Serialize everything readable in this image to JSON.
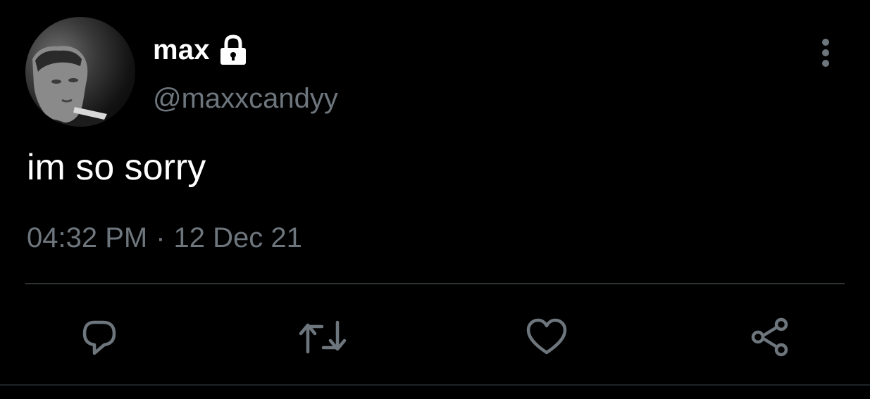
{
  "profile": {
    "display_name": "max",
    "handle": "@maxxcandyy",
    "avatar": "profile-photo",
    "protected_icon": "lock-icon"
  },
  "tweet": {
    "text": "im so sorry",
    "time": "04:32 PM",
    "separator": "·",
    "date": "12 Dec 21"
  },
  "actions": [
    {
      "name": "reply",
      "icon": "reply-icon"
    },
    {
      "name": "retweet",
      "icon": "retweet-icon"
    },
    {
      "name": "like",
      "icon": "heart-icon"
    },
    {
      "name": "share",
      "icon": "share-icon"
    }
  ],
  "menu": {
    "icon": "more-vertical-icon"
  },
  "colors": {
    "background": "#000000",
    "primary_text": "#ffffff",
    "secondary_text": "#6e767d",
    "divider": "#2f3336",
    "icon": "#6e767d"
  }
}
